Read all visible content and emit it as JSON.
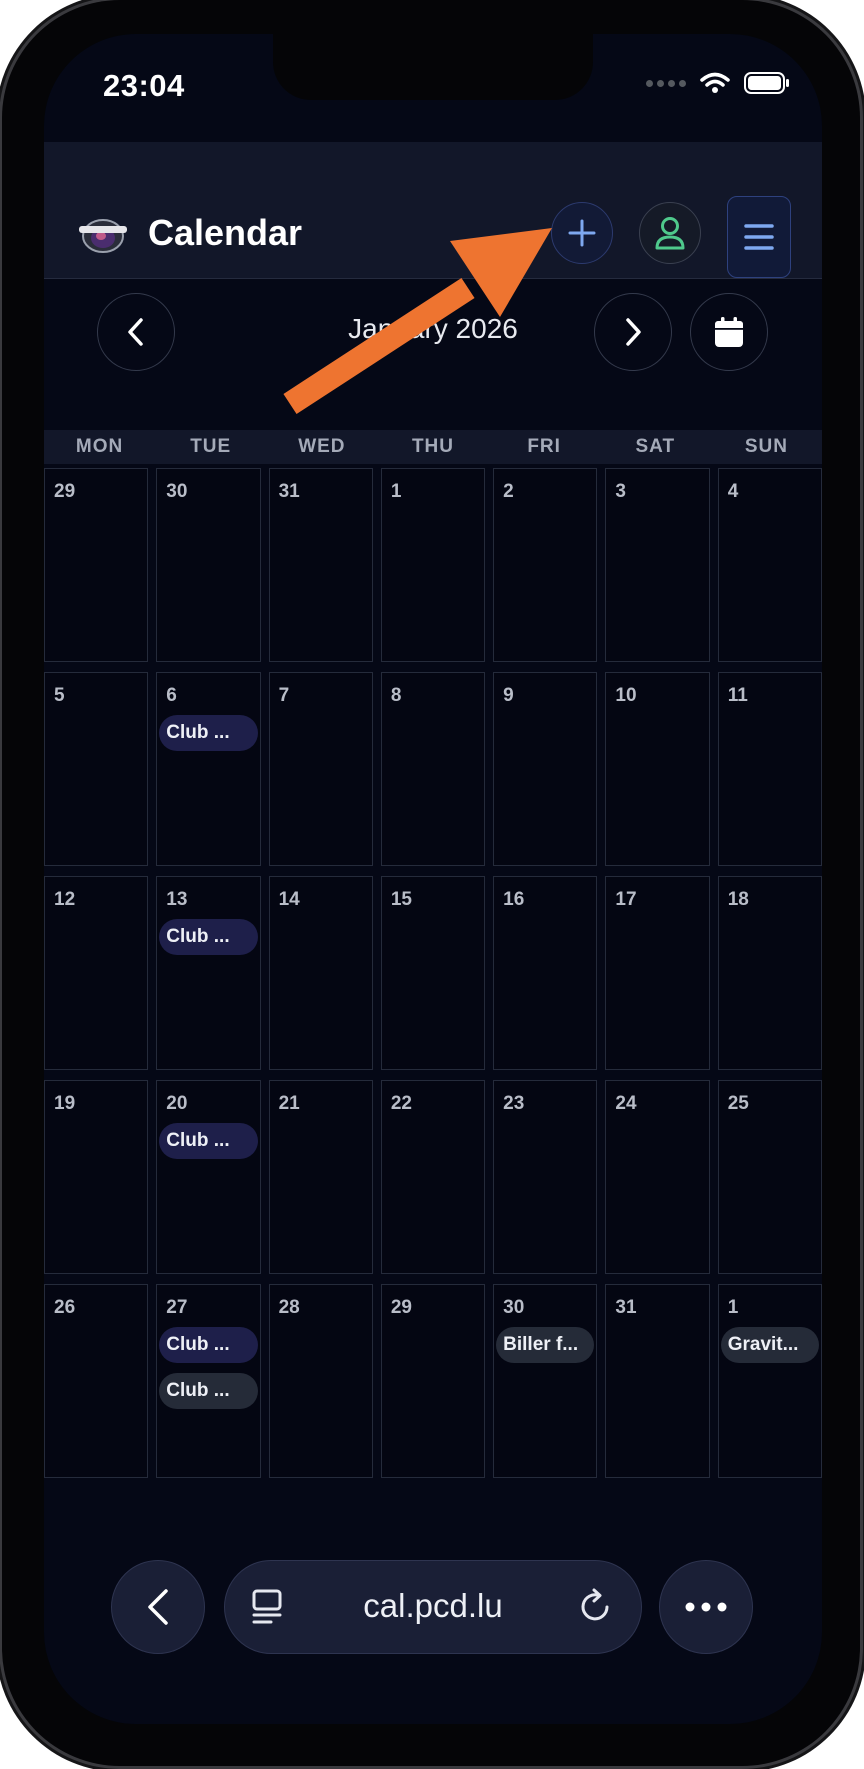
{
  "status_bar": {
    "time": "23:04"
  },
  "header": {
    "title": "Calendar",
    "logo_icon": "club-logo-icon",
    "add_icon": "plus-icon",
    "user_icon": "user-icon",
    "menu_icon": "hamburger-icon"
  },
  "month_nav": {
    "title": "January 2026"
  },
  "weekdays": [
    "MON",
    "TUE",
    "WED",
    "THU",
    "FRI",
    "SAT",
    "SUN"
  ],
  "weeks": [
    [
      {
        "day": "29",
        "events": []
      },
      {
        "day": "30",
        "events": []
      },
      {
        "day": "31",
        "events": []
      },
      {
        "day": "1",
        "events": []
      },
      {
        "day": "2",
        "events": []
      },
      {
        "day": "3",
        "events": []
      },
      {
        "day": "4",
        "events": []
      }
    ],
    [
      {
        "day": "5",
        "events": []
      },
      {
        "day": "6",
        "events": [
          {
            "title": "Club ...",
            "style": "indigo"
          }
        ]
      },
      {
        "day": "7",
        "events": []
      },
      {
        "day": "8",
        "events": []
      },
      {
        "day": "9",
        "events": []
      },
      {
        "day": "10",
        "events": []
      },
      {
        "day": "11",
        "events": []
      }
    ],
    [
      {
        "day": "12",
        "events": []
      },
      {
        "day": "13",
        "events": [
          {
            "title": "Club ...",
            "style": "indigo"
          }
        ]
      },
      {
        "day": "14",
        "events": []
      },
      {
        "day": "15",
        "events": []
      },
      {
        "day": "16",
        "events": []
      },
      {
        "day": "17",
        "events": []
      },
      {
        "day": "18",
        "events": []
      }
    ],
    [
      {
        "day": "19",
        "events": []
      },
      {
        "day": "20",
        "events": [
          {
            "title": "Club ...",
            "style": "indigo"
          }
        ]
      },
      {
        "day": "21",
        "events": []
      },
      {
        "day": "22",
        "events": []
      },
      {
        "day": "23",
        "events": []
      },
      {
        "day": "24",
        "events": []
      },
      {
        "day": "25",
        "events": []
      }
    ],
    [
      {
        "day": "26",
        "events": []
      },
      {
        "day": "27",
        "events": [
          {
            "title": "Club ...",
            "style": "indigo"
          },
          {
            "title": "Club ...",
            "style": "slate"
          }
        ]
      },
      {
        "day": "28",
        "events": []
      },
      {
        "day": "29",
        "events": []
      },
      {
        "day": "30",
        "events": [
          {
            "title": "Biller f...",
            "style": "slate"
          }
        ]
      },
      {
        "day": "31",
        "events": []
      },
      {
        "day": "1",
        "events": [
          {
            "title": "Gravit...",
            "style": "slate"
          }
        ]
      }
    ]
  ],
  "browser": {
    "url": "cal.pcd.lu"
  },
  "colors": {
    "screen_bg": "#050816",
    "header_bg": "#121729",
    "accent_blue": "#7ea8f0",
    "accent_green": "#4fc98c",
    "event_indigo": "#1e1f4a",
    "event_slate": "#252b38",
    "arrow": "#ee7430"
  }
}
